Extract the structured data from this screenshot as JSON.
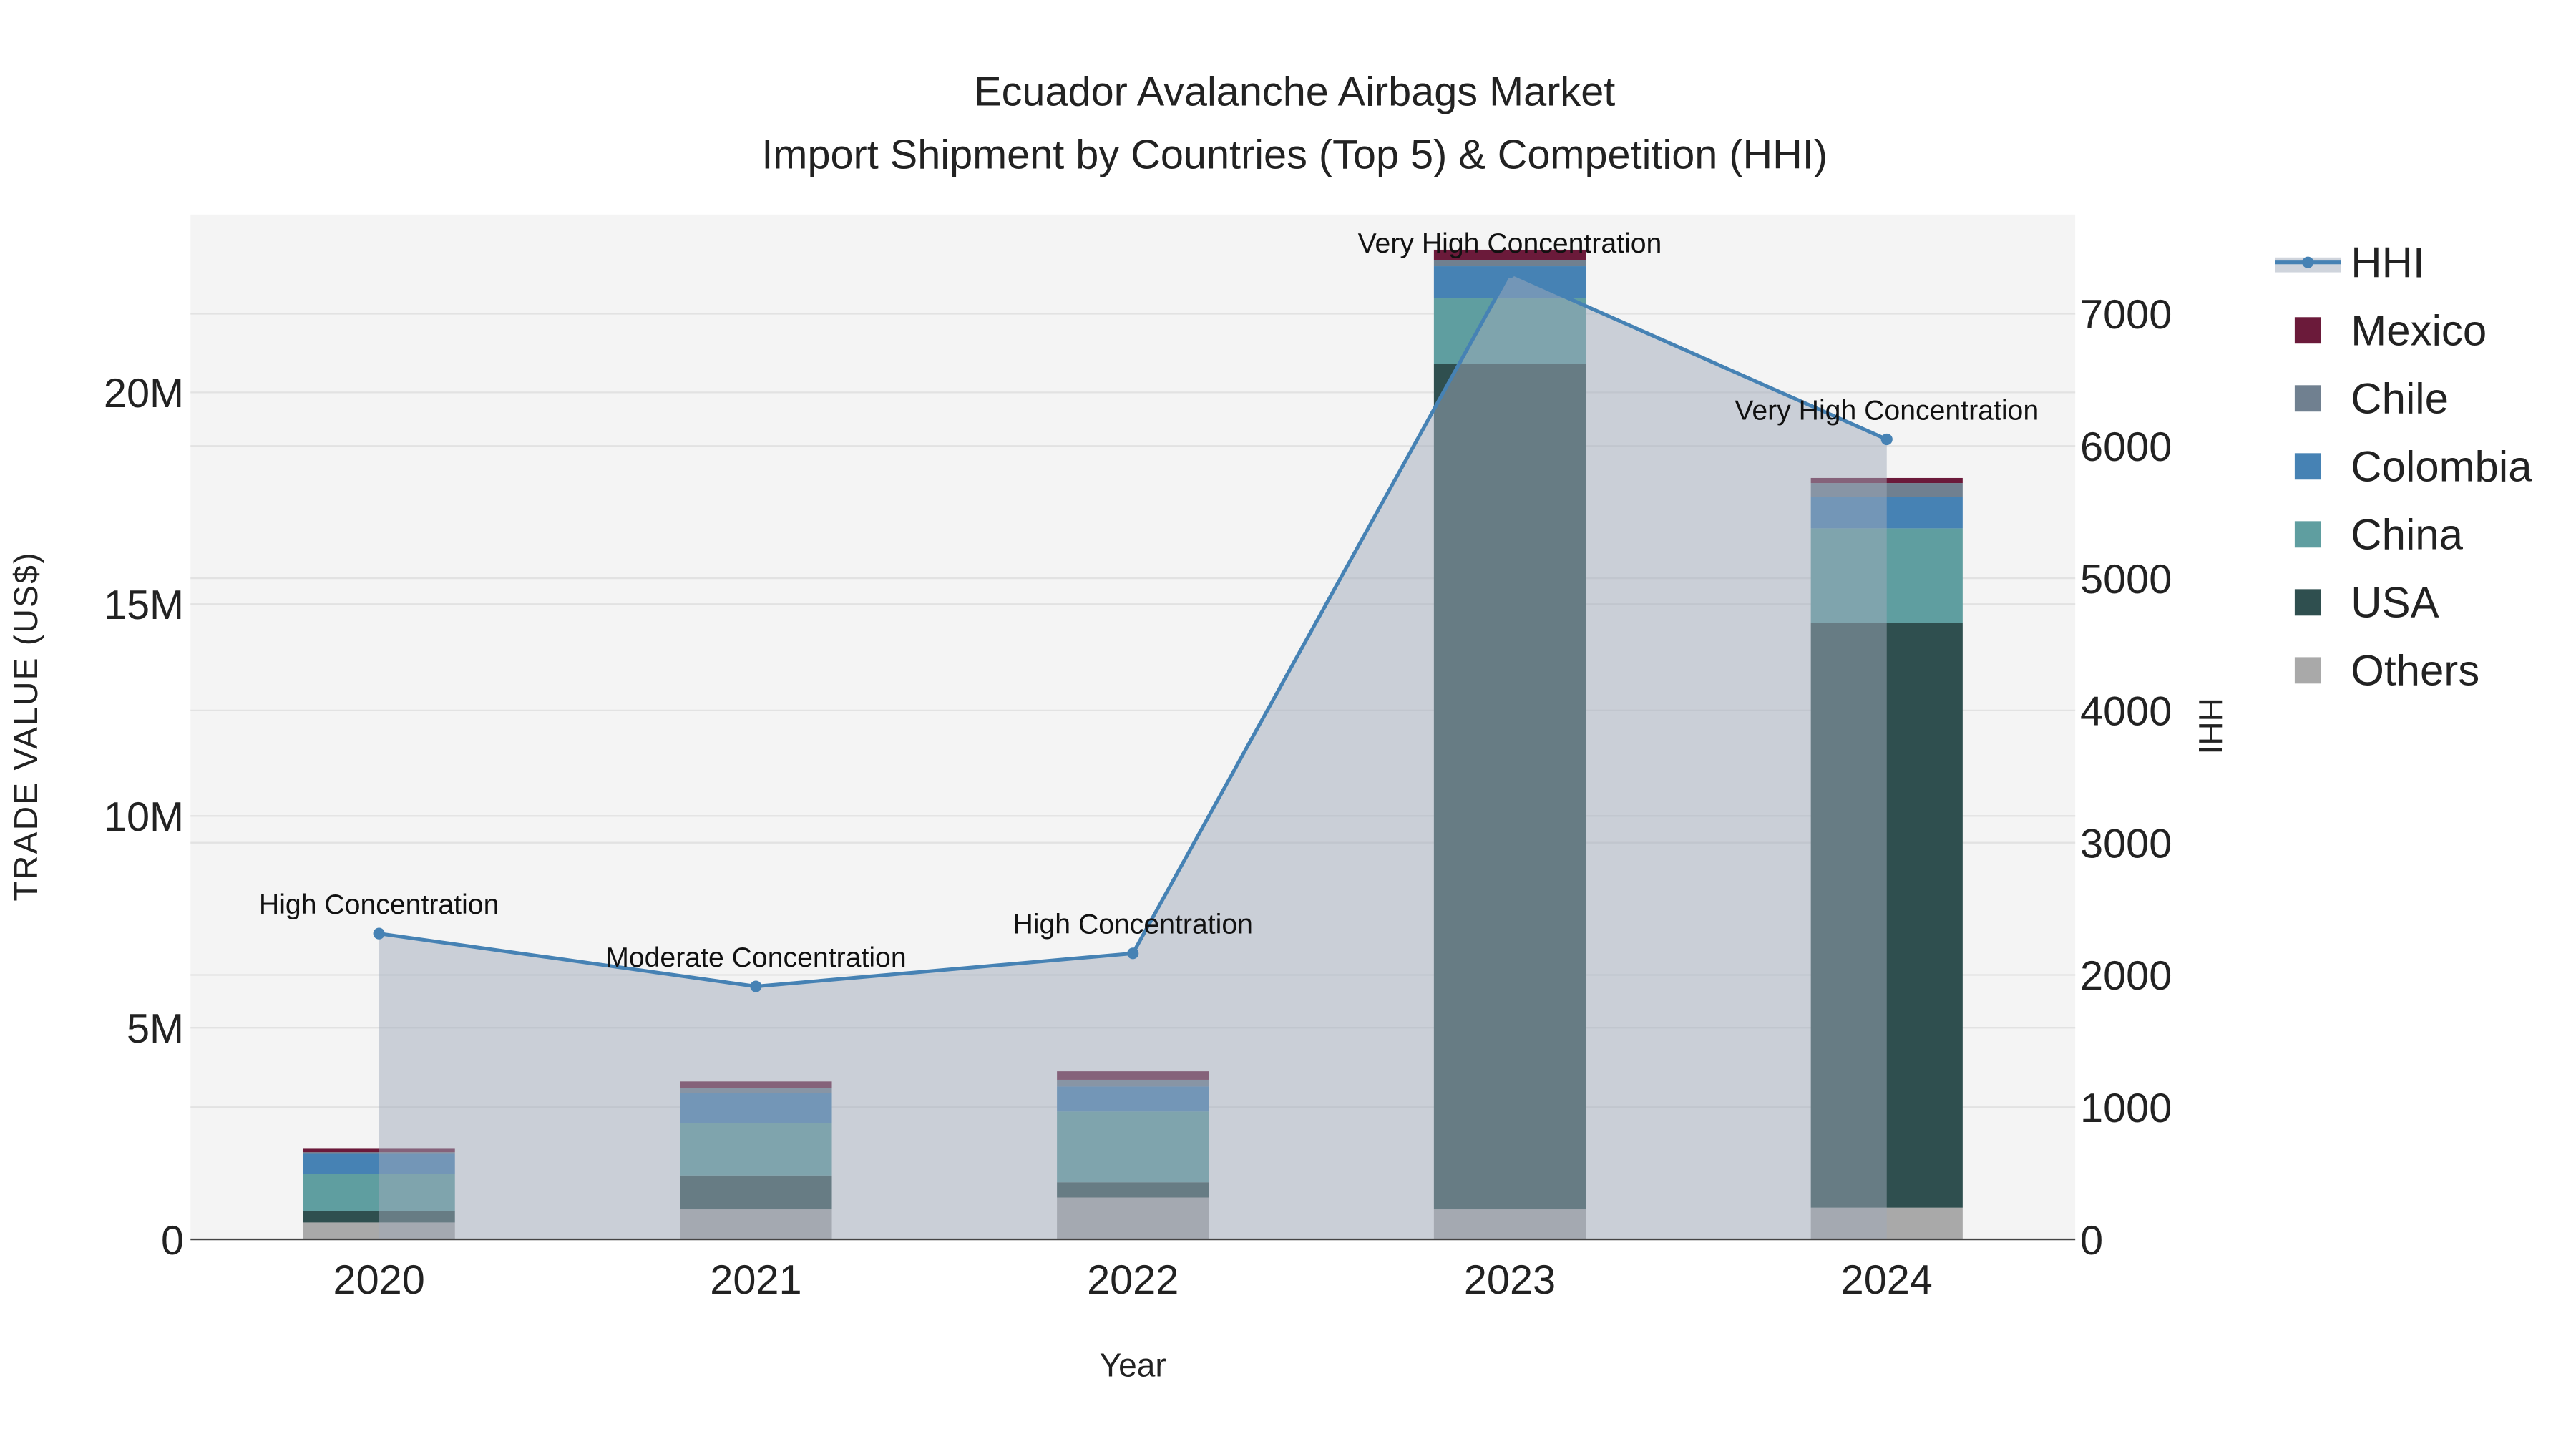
{
  "chart_data": {
    "type": "bar",
    "stacked": true,
    "title": "Ecuador Avalanche Airbags Market",
    "subtitle": "Import Shipment by Countries (Top 5) & Competition (HHI)",
    "xlabel": "Year",
    "ylabel": "TRADE VALUE (US$)",
    "y2label": "HHI",
    "categories": [
      "2020",
      "2021",
      "2022",
      "2023",
      "2024"
    ],
    "ylim": [
      0,
      24.2
    ],
    "y_unit": "M",
    "y_ticks": [
      0,
      5,
      10,
      15,
      20
    ],
    "y_tick_labels": [
      "0",
      "5M",
      "10M",
      "15M",
      "20M"
    ],
    "y2lim": [
      0,
      7750
    ],
    "y2_ticks": [
      0,
      1000,
      2000,
      3000,
      4000,
      5000,
      6000,
      7000
    ],
    "y2_tick_labels": [
      "0",
      "1000",
      "2000",
      "3000",
      "4000",
      "5000",
      "6000",
      "7000"
    ],
    "series": [
      {
        "name": "Others",
        "color": "#a9a9a9",
        "values": [
          0.4,
          0.71,
          0.99,
          0.71,
          0.75
        ]
      },
      {
        "name": "USA",
        "color": "#2f4f4f",
        "values": [
          0.27,
          0.8,
          0.36,
          19.96,
          13.81
        ]
      },
      {
        "name": "China",
        "color": "#5f9ea0",
        "values": [
          0.88,
          1.23,
          1.67,
          1.55,
          2.23
        ]
      },
      {
        "name": "Colombia",
        "color": "#4682b4",
        "values": [
          0.47,
          0.71,
          0.59,
          0.76,
          0.75
        ]
      },
      {
        "name": "Chile",
        "color": "#708090",
        "values": [
          0.04,
          0.12,
          0.16,
          0.15,
          0.32
        ]
      },
      {
        "name": "Mexico",
        "color": "#6b1a3a",
        "values": [
          0.08,
          0.16,
          0.2,
          0.24,
          0.12
        ]
      }
    ],
    "hhi": {
      "name": "HHI",
      "color": "#4682b4",
      "values": [
        2313,
        1913,
        2163,
        7313,
        6050
      ],
      "annotations": [
        "High Concentration",
        "Moderate Concentration",
        "High Concentration",
        "Very High Concentration",
        "Very High Concentration"
      ]
    },
    "legend": [
      "HHI",
      "Mexico",
      "Chile",
      "Colombia",
      "China",
      "USA",
      "Others"
    ],
    "legend_position": "right",
    "grid": true
  }
}
